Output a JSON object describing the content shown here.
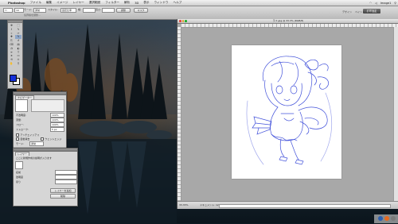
{
  "menubar": {
    "app_name": "Photoshop",
    "items": [
      "ファイル",
      "編集",
      "イメージ",
      "レイヤー",
      "選択範囲",
      "フィルター",
      "解析",
      "3D",
      "表示",
      "ウィンドウ",
      "ヘルプ"
    ],
    "right_items": [
      "Image1"
    ]
  },
  "options_bar": {
    "size_value": "10 px",
    "mode_label": "モード:",
    "mode_value": "通常",
    "style_label": "スタイル:",
    "style_value": "固定比率",
    "width_label": "幅:",
    "height_label": "高さ:",
    "refine_label": "境界線を調整...",
    "button1": "調整",
    "button2": "マスク",
    "workspace": {
      "active": "初期設定",
      "items": [
        "デザイン",
        "ペイント",
        "写真"
      ]
    }
  },
  "tools_panel": {
    "tools": [
      "move-tool",
      "marquee-tool",
      "lasso-tool",
      "quick-select-tool",
      "crop-tool",
      "eyedropper-tool",
      "healing-tool",
      "brush-tool",
      "stamp-tool",
      "history-brush-tool",
      "eraser-tool",
      "gradient-tool",
      "blur-tool",
      "dodge-tool",
      "pen-tool",
      "type-tool",
      "path-select-tool",
      "shape-tool",
      "3d-rotate-tool",
      "3d-orbit-tool",
      "hand-tool",
      "zoom-tool"
    ],
    "glyphs": [
      "✥",
      "⬚",
      "ℓ",
      "✎",
      "⌗",
      "✑",
      "✚",
      "✎",
      "⎘",
      "↺",
      "⌫",
      "▤",
      "◔",
      "◐",
      "✒",
      "T",
      "➤",
      "▭",
      "⟲",
      "⊙",
      "✋",
      "⚲"
    ],
    "foreground_color": "#1530d8",
    "background_color": "#ffffff"
  },
  "navigator_panel": {
    "tab": "ナビゲーター",
    "rows": [
      {
        "label": "不透明度:",
        "value": "100%"
      },
      {
        "label": "流量:",
        "value": "100%"
      },
      {
        "label": "フロー:",
        "value": "100%"
      },
      {
        "label": "ストローク:",
        "value": "5 px"
      }
    ],
    "checks": [
      "アンチエイリアス",
      "自動消去",
      "ウェットエッジ"
    ],
    "mode_label": "モード:",
    "mode_value": "通常"
  },
  "layer_panel": {
    "tab": "レイヤー",
    "note": "ここに新規作成の説明が入ります",
    "fields": [
      "名前",
      "透明度",
      "塗り"
    ],
    "buttons": [
      "レイヤーを追加",
      "削除"
    ]
  },
  "document": {
    "title": "ラフ.jpg @ 33.3% (RGB/8)",
    "zoom": "33.33%",
    "status": "ドキュメント: 12.0M/12.0M"
  },
  "colors": {
    "menubar": "#dcdcdc",
    "canvas_bg": "#a8a8a8",
    "sketch_line": "#2d3ed6"
  }
}
